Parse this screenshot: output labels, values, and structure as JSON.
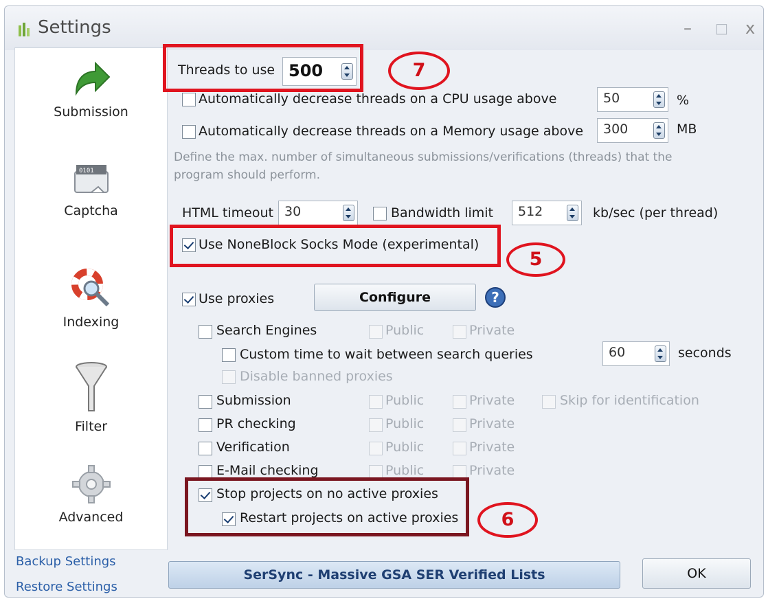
{
  "window": {
    "title": "Settings",
    "minimize": "–",
    "maximize": "□",
    "close": "x"
  },
  "sidebar": {
    "items": [
      {
        "label": "Submission",
        "icon": "green-arrow-icon"
      },
      {
        "label": "Captcha",
        "icon": "captcha-icon"
      },
      {
        "label": "Indexing",
        "icon": "lifebuoy-magnifier-icon"
      },
      {
        "label": "Filter",
        "icon": "funnel-icon"
      },
      {
        "label": "Advanced",
        "icon": "gear-icon"
      }
    ],
    "backup_label": "Backup Settings",
    "restore_label": "Restore Settings"
  },
  "threads": {
    "label": "Threads to use",
    "value": "500"
  },
  "cpu": {
    "label": "Automatically decrease threads on a CPU usage above",
    "value": "50",
    "unit": "%",
    "checked": false
  },
  "memory": {
    "label": "Automatically decrease threads on a Memory usage above",
    "value": "300",
    "unit": "MB",
    "checked": false
  },
  "description": {
    "line1": "Define the max. number of simultaneous submissions/verifications (threads) that the",
    "line2": "program should perform."
  },
  "html_timeout": {
    "label": "HTML timeout",
    "value": "30"
  },
  "bandwidth": {
    "label": "Bandwidth limit",
    "value": "512",
    "unit": "kb/sec (per thread)",
    "checked": false
  },
  "noneblock": {
    "label": "Use NoneBlock Socks Mode (experimental)",
    "checked": true
  },
  "proxies": {
    "label": "Use proxies",
    "checked": true,
    "configure_label": "Configure",
    "help_icon": "help-icon"
  },
  "proxy_rows": [
    {
      "label": "Search Engines",
      "public": "Public",
      "private": "Private"
    },
    {
      "label": "Submission",
      "public": "Public",
      "private": "Private",
      "extra": "Skip for identification"
    },
    {
      "label": "PR checking",
      "public": "Public",
      "private": "Private"
    },
    {
      "label": "Verification",
      "public": "Public",
      "private": "Private"
    },
    {
      "label": "E-Mail checking",
      "public": "Public",
      "private": "Private"
    }
  ],
  "custom_wait": {
    "label": "Custom time to wait between search queries",
    "value": "60",
    "unit": "seconds",
    "checked": false
  },
  "disable_banned": {
    "label": "Disable banned proxies"
  },
  "stop_projects": {
    "label": "Stop projects on no active proxies",
    "checked": true
  },
  "restart_projects": {
    "label": "Restart projects on active proxies",
    "checked": true
  },
  "annotations": {
    "seven": "7",
    "five": "5",
    "six": "6"
  },
  "footer": {
    "banner": "SerSync - Massive GSA SER Verified Lists",
    "ok": "OK"
  },
  "colors": {
    "annotation_red": "#e0141f",
    "annotation_dark": "#7a1620",
    "link_blue": "#2b5fa8"
  }
}
